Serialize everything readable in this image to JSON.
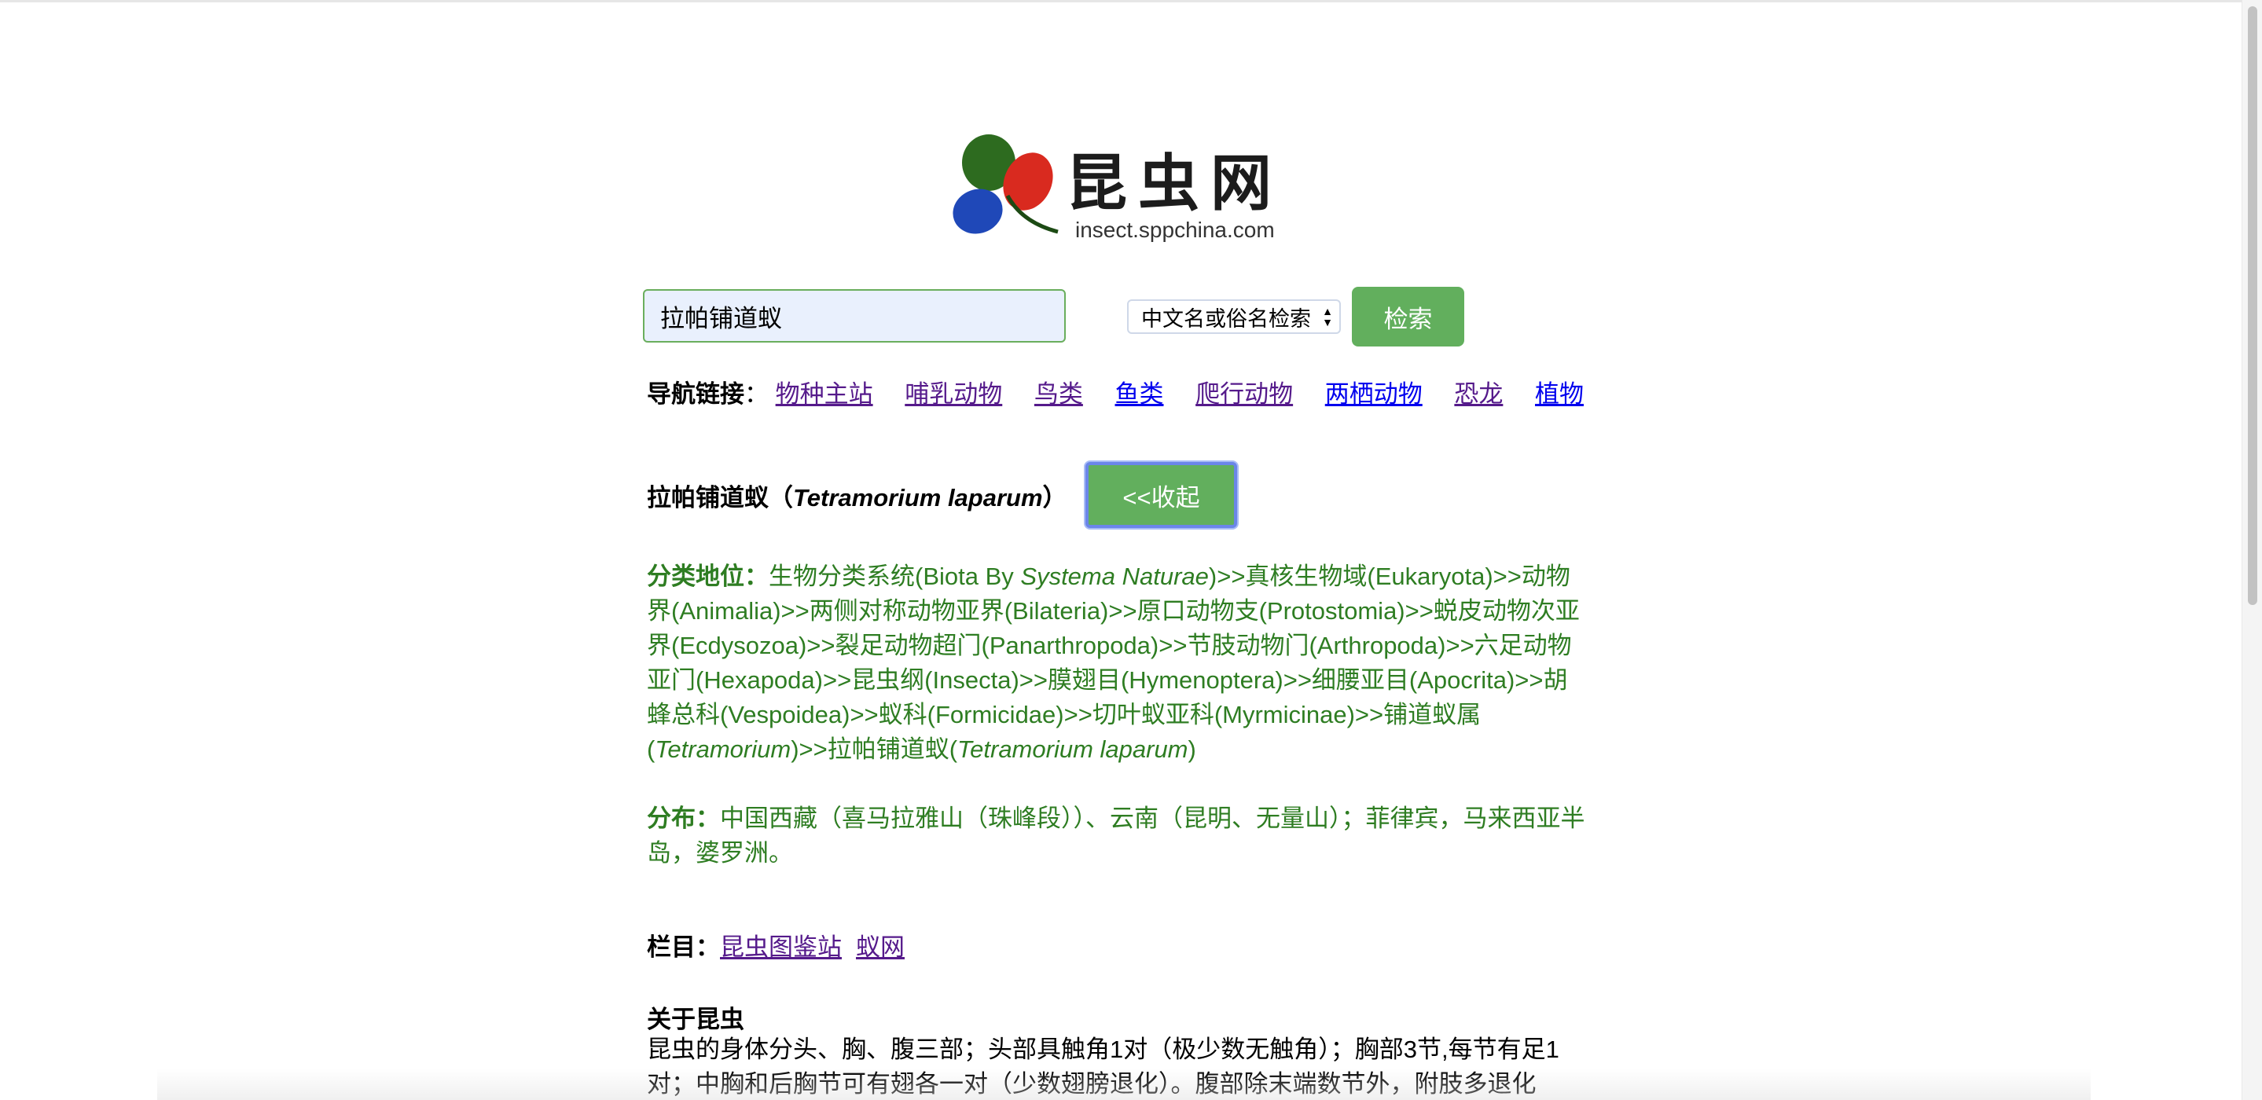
{
  "logo": {
    "title_cn": "昆虫网",
    "url_text": "insect.sppchina.com",
    "colors": {
      "green": "#2d6b1f",
      "red": "#d92a1f",
      "blue": "#1f48b8"
    }
  },
  "search": {
    "value": "拉帕铺道蚁",
    "mode_selected": "中文名或俗名检索",
    "button_label": "检索"
  },
  "nav": {
    "label": "导航链接",
    "separator": "：",
    "links": [
      {
        "label": "物种主站",
        "visited": true
      },
      {
        "label": "哺乳动物",
        "visited": true
      },
      {
        "label": "鸟类",
        "visited": true
      },
      {
        "label": "鱼类",
        "visited": false
      },
      {
        "label": "爬行动物",
        "visited": true
      },
      {
        "label": "两栖动物",
        "visited": false
      },
      {
        "label": "恐龙",
        "visited": true
      },
      {
        "label": "植物",
        "visited": false
      }
    ]
  },
  "species": {
    "name_cn": "拉帕铺道蚁",
    "open_paren": "（",
    "name_latin": "Tetramorium laparum",
    "close_paren": "）",
    "collapse_label": "<<收起"
  },
  "taxonomy": {
    "label": "分类地位：",
    "t1": "生物分类系统(Biota By ",
    "t1_italic": "Systema Naturae",
    "t2": ")>>真核生物域(Eukaryota)>>动物界(Animalia)>>两侧对称动物亚界(Bilateria)>>原口动物支(Protostomia)>>蜕皮动物次亚界(Ecdysozoa)>>裂足动物超门(Panarthropoda)>>节肢动物门(Arthropoda)>>六足动物亚门(Hexapoda)>>昆虫纲(Insecta)>>膜翅目(Hymenoptera)>>细腰亚目(Apocrita)>>胡蜂总科(Vespoidea)>>蚁科(Formicidae)>>切叶蚁亚科(Myrmicinae)>>铺道蚁属(",
    "t2_italic": "Tetramorium",
    "t3": ")>>拉帕铺道蚁(",
    "t3_italic": "Tetramorium laparum",
    "t4": ")"
  },
  "distribution": {
    "label": "分布：",
    "text": "中国西藏（喜马拉雅山（珠峰段））、云南（昆明、无量山）；菲律宾，马来西亚半岛，婆罗洲。"
  },
  "columns": {
    "label": "栏目：",
    "links": [
      "昆虫图鉴站",
      "蚁网"
    ]
  },
  "about": {
    "title": "关于昆虫",
    "text": "昆虫的身体分头、胸、腹三部；头部具触角1对（极少数无触角）；胸部3节,每节有足1对；中胸和后胸节可有翅各一对（少数翅膀退化）。腹部除末端数节外，附肢多退化"
  }
}
